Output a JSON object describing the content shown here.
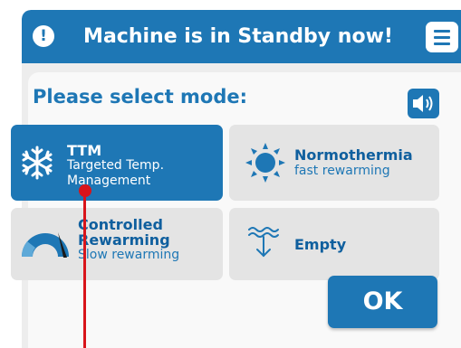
{
  "header": {
    "title": "Machine is in Standby now!",
    "alert_icon": "exclamation-icon",
    "menu_icon": "hamburger-menu-icon"
  },
  "prompt": "Please select mode:",
  "sound_icon": "speaker-icon",
  "modes": [
    {
      "title": "TTM",
      "subtitle_line1": "Targeted Temp.",
      "subtitle_line2": "Management",
      "icon": "snowflake-icon",
      "selected": true
    },
    {
      "title": "Normothermia",
      "subtitle_line1": "fast rewarming",
      "icon": "sun-icon",
      "selected": false
    },
    {
      "title_line1": "Controlled",
      "title_line2": "Rewarming",
      "subtitle_line1": "Slow rewarming",
      "icon": "gauge-icon",
      "selected": false
    },
    {
      "title": "Empty",
      "icon": "water-drain-icon",
      "selected": false
    }
  ],
  "ok_label": "OK",
  "colors": {
    "primary": "#1e77b5",
    "tile": "#e4e4e4",
    "pointer": "#d8141a"
  }
}
